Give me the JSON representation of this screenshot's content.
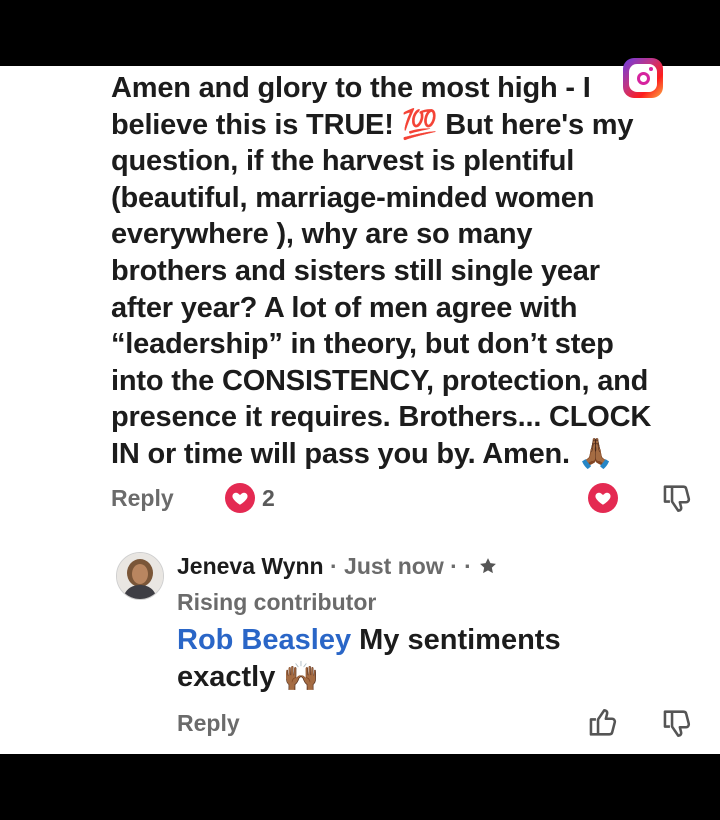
{
  "main_comment": {
    "text": "Amen and glory to the most high - I\nbelieve this is TRUE! 💯 But here's my\nquestion, if the harvest is plentiful\n(beautiful, marriage-minded women\neverywhere ), why are so many\nbrothers and sisters still single year\nafter year? A lot of men agree with\n“leadership” in theory, but don’t step\ninto the CONSISTENCY, protection, and\npresence it requires. Brothers... CLOCK\nIN or time will pass you by. Amen. 🙏🏾",
    "reply_label": "Reply",
    "reaction_count": "2"
  },
  "reply_comment": {
    "author": "Jeneva Wynn",
    "separator": " · ",
    "time": "Just now",
    "badge_prefix": " · · ",
    "badge": "Rising contributor",
    "mention": "Rob Beasley",
    "text": " My sentiments exactly 🙌🏾",
    "reply_label": "Reply"
  },
  "colors": {
    "heart": "#e42a52",
    "mention": "#2a66c7",
    "muted": "#6b6b6b"
  },
  "icons": {
    "reaction": "heart-icon",
    "dislike": "thumbs-down-icon",
    "like": "thumbs-up-icon",
    "badge": "star-icon",
    "overlay": "instagram-logo"
  }
}
